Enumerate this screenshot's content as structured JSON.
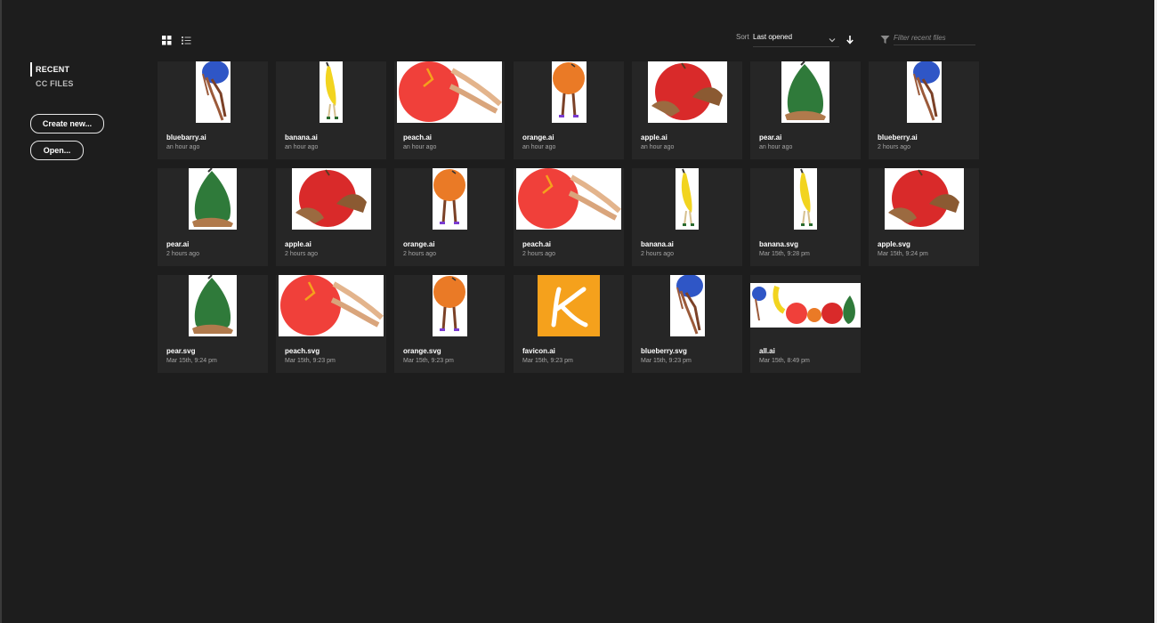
{
  "nav": {
    "items": [
      {
        "label": "RECENT",
        "active": true
      },
      {
        "label": "CC FILES",
        "active": false
      }
    ],
    "create_label": "Create new...",
    "open_label": "Open..."
  },
  "toolbar": {
    "grid_view_icon": "grid-view-icon",
    "list_view_icon": "list-view-icon",
    "sort_label": "Sort",
    "sort_value": "Last opened",
    "sort_direction_icon": "arrow-down-icon",
    "filter_icon": "filter-funnel-icon",
    "filter_placeholder": "Filter recent files"
  },
  "files": [
    {
      "name": "bluebarry.ai",
      "date": "an hour ago",
      "art": "blueberry"
    },
    {
      "name": "banana.ai",
      "date": "an hour ago",
      "art": "banana"
    },
    {
      "name": "peach.ai",
      "date": "an hour ago",
      "art": "peach"
    },
    {
      "name": "orange.ai",
      "date": "an hour ago",
      "art": "orange"
    },
    {
      "name": "apple.ai",
      "date": "an hour ago",
      "art": "apple"
    },
    {
      "name": "pear.ai",
      "date": "an hour ago",
      "art": "pear"
    },
    {
      "name": "blueberry.ai",
      "date": "2 hours ago",
      "art": "blueberry"
    },
    {
      "name": "pear.ai",
      "date": "2 hours ago",
      "art": "pear"
    },
    {
      "name": "apple.ai",
      "date": "2 hours ago",
      "art": "apple"
    },
    {
      "name": "orange.ai",
      "date": "2 hours ago",
      "art": "orange"
    },
    {
      "name": "peach.ai",
      "date": "2 hours ago",
      "art": "peach"
    },
    {
      "name": "banana.ai",
      "date": "2 hours ago",
      "art": "banana"
    },
    {
      "name": "banana.svg",
      "date": "Mar 15th, 9:28 pm",
      "art": "banana"
    },
    {
      "name": "apple.svg",
      "date": "Mar 15th, 9:24 pm",
      "art": "apple"
    },
    {
      "name": "pear.svg",
      "date": "Mar 15th, 9:24 pm",
      "art": "pear"
    },
    {
      "name": "peach.svg",
      "date": "Mar 15th, 9:23 pm",
      "art": "peach"
    },
    {
      "name": "orange.svg",
      "date": "Mar 15th, 9:23 pm",
      "art": "orange"
    },
    {
      "name": "favicon.ai",
      "date": "Mar 15th, 9:23 pm",
      "art": "favicon"
    },
    {
      "name": "blueberry.svg",
      "date": "Mar 15th, 9:23 pm",
      "art": "blueberry"
    },
    {
      "name": "all.ai",
      "date": "Mar 15th, 8:49 pm",
      "art": "all"
    }
  ],
  "colors": {
    "background": "#1d1d1d",
    "card": "#262626",
    "blueberry": "#2f56c6",
    "banana": "#f2d41f",
    "peach": "#f0403a",
    "orange": "#ea7a26",
    "apple": "#d92a2a",
    "pear": "#2f7a3a",
    "favicon": "#f5a11c"
  }
}
